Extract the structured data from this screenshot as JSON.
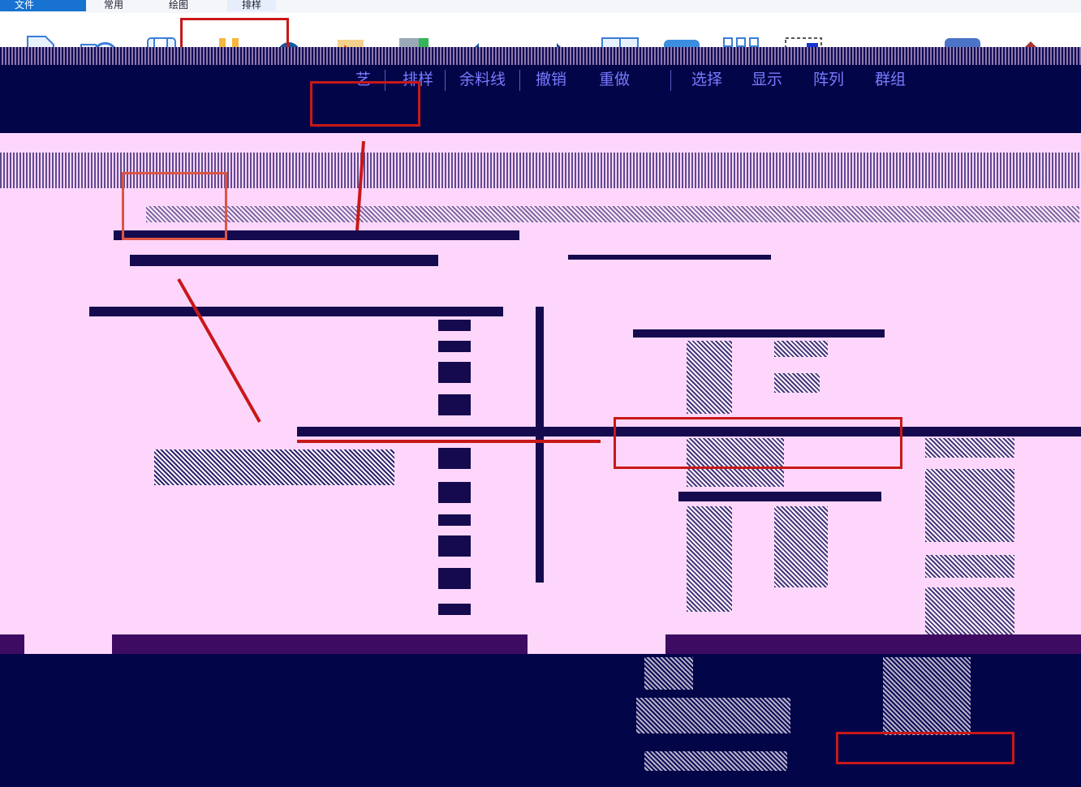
{
  "tabs": [
    {
      "label": "文件",
      "active": true
    },
    {
      "label": "常用",
      "active": false
    },
    {
      "label": "绘图",
      "active": false
    },
    {
      "label": "排样",
      "active": false
    }
  ],
  "toolbar_icons": [
    {
      "name": "new-file-icon"
    },
    {
      "name": "open-folder-icon"
    },
    {
      "name": "save-icon"
    },
    {
      "name": "magnet-icon"
    },
    {
      "name": "gear-icon"
    },
    {
      "name": "play-flag-icon"
    },
    {
      "name": "layout-grid-icon"
    },
    {
      "name": "undo-icon"
    },
    {
      "name": "redo-icon"
    },
    {
      "name": "select-window-icon"
    },
    {
      "name": "display-icon"
    },
    {
      "name": "array-icon"
    },
    {
      "name": "group-icon"
    },
    {
      "name": "nc-file-icon"
    },
    {
      "name": "eject-icon"
    }
  ],
  "menu": {
    "items": [
      "艺",
      "排样",
      "余料线",
      "撤销",
      "重做",
      "选择",
      "显示",
      "阵列",
      "群组"
    ]
  },
  "colors": {
    "accent": "#1772d0",
    "highlight_frame": "#c81818",
    "dark_bg": "#020648",
    "pink_bg": "#ffd6fb"
  }
}
